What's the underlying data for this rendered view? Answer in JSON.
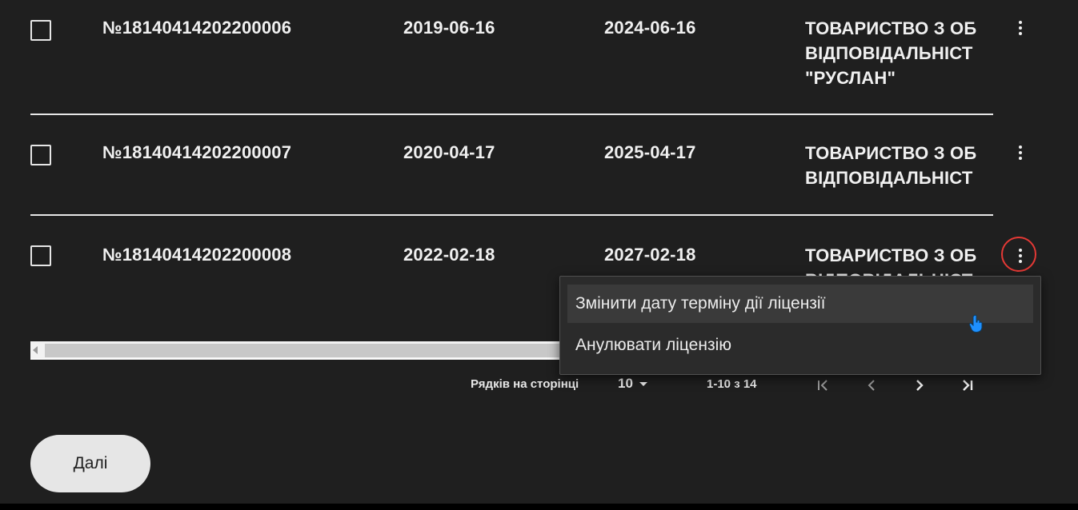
{
  "table": {
    "rows": [
      {
        "license_number": "№18140414202200006",
        "start_date": "2019-06-16",
        "end_date": "2024-06-16",
        "org_line1": "ТОВАРИСТВО З ОБ",
        "org_line2": "ВІДПОВІДАЛЬНІСТ",
        "org_line3": "\"РУСЛАН\""
      },
      {
        "license_number": "№18140414202200007",
        "start_date": "2020-04-17",
        "end_date": "2025-04-17",
        "org_line1": "ТОВАРИСТВО З ОБ",
        "org_line2": "ВІДПОВІДАЛЬНІСТ"
      },
      {
        "license_number": "№18140414202200008",
        "start_date": "2022-02-18",
        "end_date": "2027-02-18",
        "org_line1": "ТОВАРИСТВО З ОБ",
        "org_line2": "ВІДПОВІДАЛЬНІСТ"
      }
    ]
  },
  "context_menu": {
    "items": [
      {
        "label": "Змінити дату терміну дії ліцензії"
      },
      {
        "label": "Анулювати ліцензію"
      }
    ]
  },
  "pagination": {
    "rows_per_page_label": "Рядків на сторінці",
    "rows_per_page_value": "10",
    "range_text": "1-10 з 14"
  },
  "footer": {
    "next_button_label": "Далі"
  },
  "colors": {
    "background": "#1f1f1f",
    "highlight_circle": "#e53935",
    "cursor": "#1e90ff"
  },
  "icons": [
    "more-vert-icon",
    "first-page-icon",
    "previous-page-icon",
    "next-page-icon",
    "last-page-icon",
    "caret-down-icon",
    "hand-cursor-icon"
  ]
}
